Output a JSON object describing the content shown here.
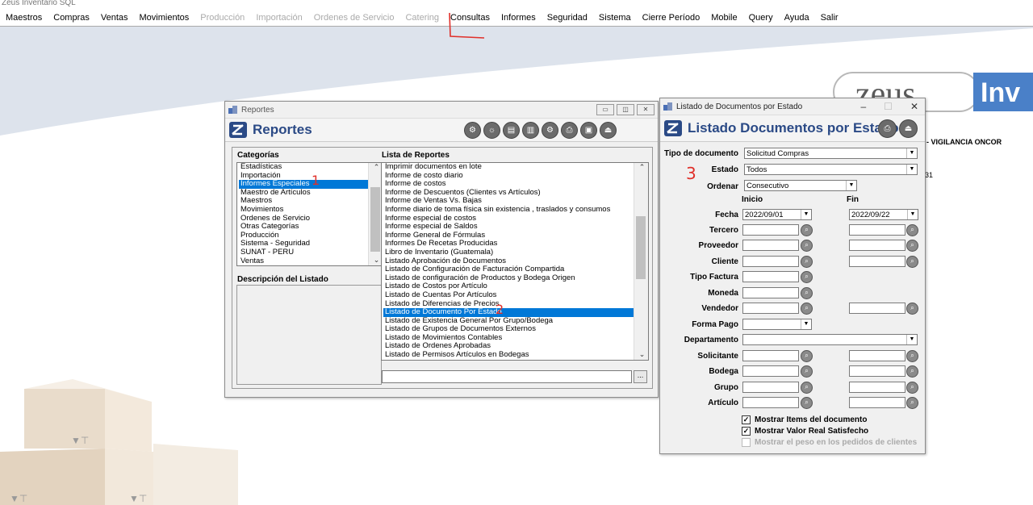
{
  "app": {
    "title": "Zeus Inventario SQL"
  },
  "menu": [
    {
      "label": "Maestros",
      "enabled": true
    },
    {
      "label": "Compras",
      "enabled": true
    },
    {
      "label": "Ventas",
      "enabled": true
    },
    {
      "label": "Movimientos",
      "enabled": true
    },
    {
      "label": "Producción",
      "enabled": false
    },
    {
      "label": "Importación",
      "enabled": false
    },
    {
      "label": "Ordenes de Servicio",
      "enabled": false
    },
    {
      "label": "Catering",
      "enabled": false
    },
    {
      "label": "Consultas",
      "enabled": true
    },
    {
      "label": "Informes",
      "enabled": true
    },
    {
      "label": "Seguridad",
      "enabled": true
    },
    {
      "label": "Sistema",
      "enabled": true
    },
    {
      "label": "Cierre Período",
      "enabled": true
    },
    {
      "label": "Mobile",
      "enabled": true
    },
    {
      "label": "Query",
      "enabled": true
    },
    {
      "label": "Ayuda",
      "enabled": true
    },
    {
      "label": "Salir",
      "enabled": true
    }
  ],
  "background": {
    "logo_text": "zeus",
    "logo_suffix": "Inv",
    "company": "- VIGILANCIA ONCOR",
    "partial_number": "31"
  },
  "annotations": {
    "one": "1",
    "two": "2",
    "three": "3"
  },
  "reportes": {
    "caption": "Reportes",
    "title": "Reportes",
    "categorias_label": "Categorías",
    "categorias": [
      "Estadísticas",
      "Importación",
      "Informes Especiales",
      "Maestro de Artículos",
      "Maestros",
      "Movimientos",
      "Ordenes de Servicio",
      "Otras Categorías",
      "Producción",
      "Sistema - Seguridad",
      "SUNAT - PERU",
      "Ventas"
    ],
    "categoria_selected_index": 2,
    "descripcion_label": "Descripción del Listado",
    "lista_label": "Lista de Reportes",
    "lista": [
      "Imprimir documentos en lote",
      "Informe de costo diario",
      "Informe de costos",
      "Informe de Descuentos (Clientes vs Artículos)",
      "Informe de Ventas Vs. Bajas",
      "Informe diario de toma física sin existencia , traslados y consumos",
      "Informe especial de costos",
      "Informe especial de Saldos",
      "Informe General de Fórmulas",
      "Informes De Recetas Producidas",
      "Libro de Inventario (Guatemala)",
      "Listado Aprobación de Documentos",
      "Listado de Configuración de Facturación Compartida",
      "Listado de configuración de Productos y Bodega Origen",
      "Listado de Costos por Artículo",
      "Listado de Cuentas Por Artículos",
      "Listado de Diferencias de Precios",
      "Listado de Documento Por Estado",
      "Listado de Existencia General Por Grupo/Bodega",
      "Listado de Grupos de Documentos Externos",
      "Listado de Movimientos Contables",
      "Listado de Ordenes Aprobadas",
      "Listado de Permisos Artículos en Bodegas"
    ],
    "lista_selected_index": 17,
    "path_button": "..."
  },
  "listado": {
    "caption": "Listado de Documentos por Estado",
    "title": "Listado Documentos por Estado",
    "labels": {
      "tipo_documento": "Tipo de documento",
      "estado": "Estado",
      "ordenar": "Ordenar",
      "inicio": "Inicio",
      "fin": "Fin",
      "fecha": "Fecha",
      "tercero": "Tercero",
      "proveedor": "Proveedor",
      "cliente": "Cliente",
      "tipo_factura": "Tipo Factura",
      "moneda": "Moneda",
      "vendedor": "Vendedor",
      "forma_pago": "Forma Pago",
      "departamento": "Departamento",
      "solicitante": "Solicitante",
      "bodega": "Bodega",
      "grupo": "Grupo",
      "articulo": "Artículo"
    },
    "values": {
      "tipo_documento": "Solicitud Compras",
      "estado": "Todos",
      "ordenar": "Consecutivo",
      "fecha_inicio": "2022/09/01",
      "fecha_fin": "2022/09/22"
    },
    "checks": [
      {
        "label": "Mostrar Items del documento",
        "checked": true,
        "enabled": true
      },
      {
        "label": "Mostrar Valor Real Satisfecho",
        "checked": true,
        "enabled": true
      },
      {
        "label": "Mostrar el peso en los pedidos de clientes",
        "checked": false,
        "enabled": false
      }
    ]
  }
}
